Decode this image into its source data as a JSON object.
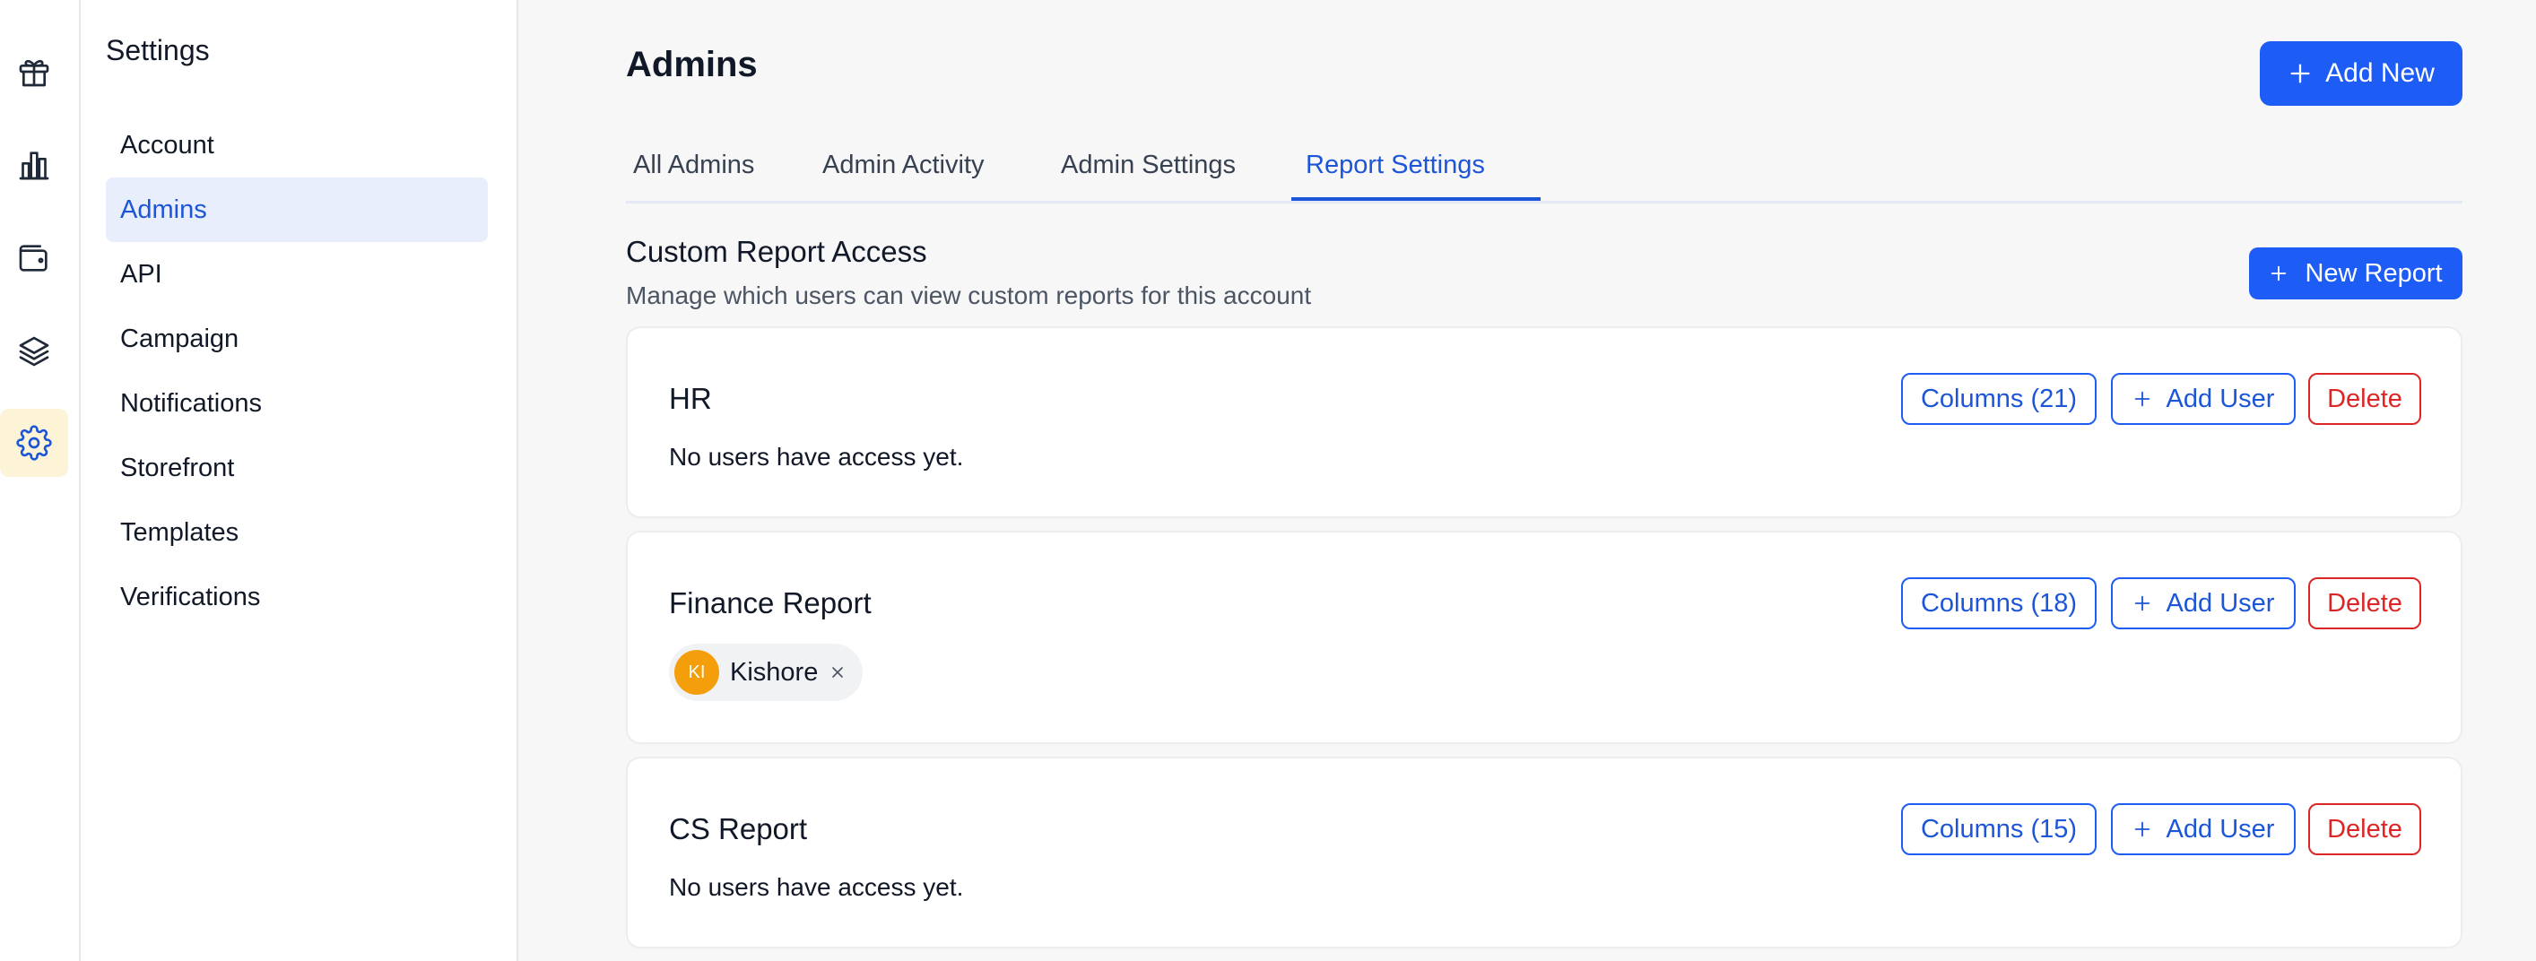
{
  "rail": {
    "items": [
      {
        "icon": "gift-icon"
      },
      {
        "icon": "bar-chart-icon"
      },
      {
        "icon": "wallet-icon"
      },
      {
        "icon": "layers-icon"
      },
      {
        "icon": "gear-icon",
        "active": true
      }
    ],
    "active_bg": "#fdf3d6"
  },
  "sidebar": {
    "title": "Settings",
    "items": [
      {
        "label": "Account"
      },
      {
        "label": "Admins",
        "active": true
      },
      {
        "label": "API"
      },
      {
        "label": "Campaign"
      },
      {
        "label": "Notifications"
      },
      {
        "label": "Storefront"
      },
      {
        "label": "Templates"
      },
      {
        "label": "Verifications"
      }
    ]
  },
  "header": {
    "title": "Admins",
    "add_new_label": "Add New"
  },
  "tabs": [
    {
      "label": "All Admins"
    },
    {
      "label": "Admin Activity"
    },
    {
      "label": "Admin Settings"
    },
    {
      "label": "Report Settings",
      "active": true
    }
  ],
  "section": {
    "title": "Custom Report Access",
    "subtitle": "Manage which users can view custom reports for this account",
    "new_report_label": "New Report"
  },
  "reports": [
    {
      "name": "HR",
      "columns_label": "Columns (21)",
      "add_user_label": "Add User",
      "delete_label": "Delete",
      "empty_text": "No users have access yet.",
      "users": []
    },
    {
      "name": "Finance Report",
      "columns_label": "Columns (18)",
      "add_user_label": "Add User",
      "delete_label": "Delete",
      "empty_text": "",
      "users": [
        {
          "initials": "KI",
          "name": "Kishore"
        }
      ]
    },
    {
      "name": "CS Report",
      "columns_label": "Columns (15)",
      "add_user_label": "Add User",
      "delete_label": "Delete",
      "empty_text": "No users have access yet.",
      "users": []
    }
  ],
  "colors": {
    "primary": "#1d5cf5",
    "link": "#1d55d8",
    "danger": "#dc2626",
    "avatar": "#f59e0b"
  }
}
